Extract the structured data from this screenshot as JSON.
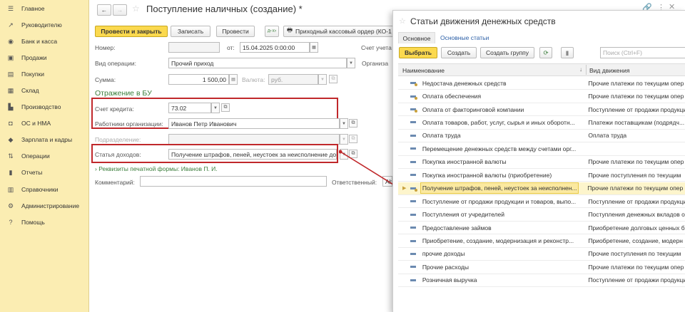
{
  "sidebar": {
    "items": [
      {
        "label": "Главное",
        "icon": "menu-icon"
      },
      {
        "label": "Руководителю",
        "icon": "trend-icon"
      },
      {
        "label": "Банк и касса",
        "icon": "bank-icon"
      },
      {
        "label": "Продажи",
        "icon": "cart-icon"
      },
      {
        "label": "Покупки",
        "icon": "basket-icon"
      },
      {
        "label": "Склад",
        "icon": "warehouse-icon"
      },
      {
        "label": "Производство",
        "icon": "factory-icon"
      },
      {
        "label": "ОС и НМА",
        "icon": "assets-icon"
      },
      {
        "label": "Зарплата и кадры",
        "icon": "people-icon"
      },
      {
        "label": "Операции",
        "icon": "operations-icon"
      },
      {
        "label": "Отчеты",
        "icon": "chart-icon"
      },
      {
        "label": "Справочники",
        "icon": "book-icon"
      },
      {
        "label": "Администрирование",
        "icon": "gear-icon"
      },
      {
        "label": "Помощь",
        "icon": "help-icon"
      }
    ]
  },
  "doc": {
    "title": "Поступление наличных (создание) *",
    "toolbar": {
      "post_close": "Провести и закрыть",
      "save": "Записать",
      "post": "Провести",
      "dtkt": "Дт Кт",
      "print": "Приходный кассовый ордер (КО-1"
    },
    "labels": {
      "number": "Номер:",
      "from": "от:",
      "account": "Счет учета",
      "op_type": "Вид операции:",
      "org": "Организа",
      "sum": "Сумма:",
      "currency": "Валюта:",
      "section": "Отражение в БУ",
      "credit_account": "Счет кредита:",
      "employees": "Работники организации:",
      "subdivision": "Подразделение:",
      "income_item": "Статья доходов:",
      "print_details": "Реквизиты печатной формы: Иванов П. И.",
      "comment": "Комментарий:",
      "responsible": "Ответственный:"
    },
    "values": {
      "number": "",
      "date": "15.04.2025  0:00:00",
      "op_type": "Прочий приход",
      "sum": "1 500,00",
      "currency": "руб.",
      "credit_account": "73.02",
      "employee": "Иванов Петр Иванович",
      "subdivision": "",
      "income_item": "Получение штрафов, пеней, неустоек за неисполнение до",
      "comment": "",
      "responsible": "Ab"
    }
  },
  "dialog": {
    "title": "Статьи движения денежных средств",
    "tabs": [
      "Основное",
      "Основные статьи"
    ],
    "buttons": {
      "select": "Выбрать",
      "create": "Создать",
      "create_group": "Создать группу"
    },
    "search_placeholder": "Поиск (Ctrl+F)",
    "columns": {
      "name": "Наименование",
      "movement": "Вид движения"
    },
    "rows": [
      {
        "name": "Недостача денежных средств",
        "movement": "Прочие платежи по текущим опер",
        "dot": true
      },
      {
        "name": "Оплата обеспечения",
        "movement": "Прочие платежи по текущим опер",
        "dot": true
      },
      {
        "name": "Оплата от факторинговой компании",
        "movement": "Поступление от продажи продукци",
        "dot": true
      },
      {
        "name": "Оплата товаров, работ, услуг, сырья и иных оборотн...",
        "movement": "Платежи поставщикам (подрядч...",
        "dot": false
      },
      {
        "name": "Оплата труда",
        "movement": "Оплата труда",
        "dot": false
      },
      {
        "name": "Перемещение денежных средств между счетами орг...",
        "movement": "",
        "dot": false
      },
      {
        "name": "Покупка иностранной валюты",
        "movement": "Прочие платежи по текущим опер",
        "dot": false
      },
      {
        "name": "Покупка иностранной валюты (приобретение)",
        "movement": "Прочие поступления по текущим",
        "dot": false
      },
      {
        "name": "Получение штрафов, пеней, неустоек за неисполнен...",
        "movement": "Прочие платежи по текущим опер",
        "dot": true
      },
      {
        "name": "Поступление от продажи продукции и товаров, выпо...",
        "movement": "Поступление от продажи продукци",
        "dot": false
      },
      {
        "name": "Поступления от учредителей",
        "movement": "Поступления денежных вкладов о",
        "dot": false
      },
      {
        "name": "Предоставление займов",
        "movement": "Приобретение долговых ценных б",
        "dot": false
      },
      {
        "name": "Приобретение, создание, модернизация и реконстр...",
        "movement": "Приобретение, создание, модерн",
        "dot": false
      },
      {
        "name": "прочие доходы",
        "movement": "Прочие поступления по текущим",
        "dot": false
      },
      {
        "name": "Прочие расходы",
        "movement": "Прочие платежи по текущим опер",
        "dot": false
      },
      {
        "name": "Розничная выручка",
        "movement": "Поступление от продажи продукци",
        "dot": false
      }
    ],
    "selected_index": 8
  },
  "colors": {
    "sidebar": "#fbedb2",
    "primary_button": "#fbd94e",
    "highlight": "#c0282b",
    "section": "#3a7d3a"
  }
}
